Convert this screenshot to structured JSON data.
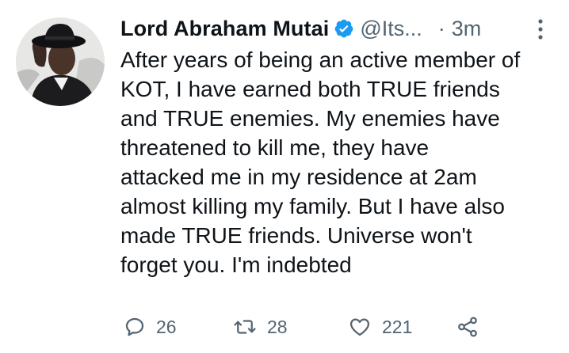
{
  "tweet": {
    "display_name": "Lord Abraham Mutai",
    "handle": "@Its...",
    "separator": "·",
    "time": "3m",
    "text": "After years of being an active member of\nKOT, I have earned both TRUE friends\nand TRUE enemies. My enemies have\nthreatened to kill me, they have\nattacked me in my residence at 2am\nalmost killing my family. But I have also\nmade TRUE friends. Universe won't\nforget you. I'm indebted",
    "verified": true
  },
  "actions": {
    "reply_count": "26",
    "retweet_count": "28",
    "like_count": "221"
  },
  "icons": {
    "verified": "verified-badge-icon",
    "more": "more-options-icon",
    "reply": "reply-icon",
    "retweet": "retweet-icon",
    "like": "heart-icon",
    "share": "share-icon"
  },
  "colors": {
    "verified_blue": "#1d9bf0",
    "text_primary": "#0f1419",
    "text_secondary": "#536471"
  }
}
